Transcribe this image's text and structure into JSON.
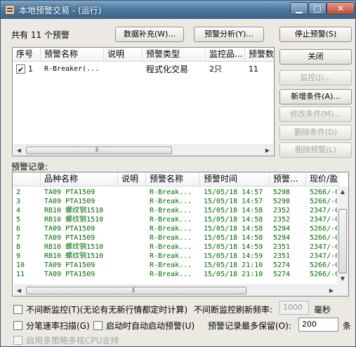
{
  "window": {
    "title": "本地预警交易 - (运行)"
  },
  "toolbar": {
    "count_label": "共有 11 个预警",
    "data_fill_button": "数据补充(W)...",
    "analysis_button": "预警分析(Y)...",
    "stop_button": "停止预警(S)"
  },
  "side_buttons": {
    "close": "关闭",
    "monitor": "监控(J)...",
    "add_condition": "新增条件(A)...",
    "modify_condition": "修改条件(M)...",
    "delete_condition": "删除条件(D)",
    "delete_alert": "删除预警(L)"
  },
  "alert_list": {
    "columns": [
      "序号",
      "预警名称",
      "说明",
      "预警类型",
      "监控品...",
      "预警数"
    ],
    "rows": [
      {
        "checked": true,
        "index": "1",
        "name": "R-Breaker(...",
        "desc": "",
        "type": "程式化交易",
        "products": "2只",
        "count": "11"
      }
    ]
  },
  "records": {
    "label": "预警记录:",
    "columns": [
      "",
      "品种名称",
      "说明",
      "预警名称",
      "预警时间",
      "预警...",
      "现价/盈"
    ],
    "rows": [
      {
        "num": "2",
        "product": "TA09 PTA1509",
        "desc": "",
        "alert": "R-Break...",
        "time": "15/05/18 14:57",
        "price": "5298",
        "cur": "5266/-0"
      },
      {
        "num": "3",
        "product": "TA09 PTA1509",
        "desc": "",
        "alert": "R-Break...",
        "time": "15/05/18 14:57",
        "price": "5298",
        "cur": "5266/-0"
      },
      {
        "num": "4",
        "product": "RB10 螺纹钢1510",
        "desc": "",
        "alert": "R-Break...",
        "time": "15/05/18 14:58",
        "price": "2352",
        "cur": "2347/-0"
      },
      {
        "num": "5",
        "product": "RB10 螺纹钢1510",
        "desc": "",
        "alert": "R-Break...",
        "time": "15/05/18 14:58",
        "price": "2352",
        "cur": "2347/-0"
      },
      {
        "num": "6",
        "product": "TA09 PTA1509",
        "desc": "",
        "alert": "R-Break...",
        "time": "15/05/18 14:58",
        "price": "5294",
        "cur": "5266/-0"
      },
      {
        "num": "7",
        "product": "TA09 PTA1509",
        "desc": "",
        "alert": "R-Break...",
        "time": "15/05/18 14:58",
        "price": "5294",
        "cur": "5266/-0"
      },
      {
        "num": "8",
        "product": "RB10 螺纹钢1510",
        "desc": "",
        "alert": "R-Break...",
        "time": "15/05/18 14:59",
        "price": "2351",
        "cur": "2347/-0"
      },
      {
        "num": "9",
        "product": "RB10 螺纹钢1510",
        "desc": "",
        "alert": "R-Break...",
        "time": "15/05/18 14:59",
        "price": "2351",
        "cur": "2347/-0"
      },
      {
        "num": "10",
        "product": "TA09 PTA1509",
        "desc": "",
        "alert": "R-Break...",
        "time": "15/05/18 21:10",
        "price": "5274",
        "cur": "5266/-0"
      },
      {
        "num": "11",
        "product": "TA09 PTA1509",
        "desc": "",
        "alert": "R-Break...",
        "time": "15/05/18 21:10",
        "price": "5274",
        "cur": "5266/-0"
      }
    ]
  },
  "options": {
    "continuous_monitor": {
      "label": "不间断监控(T)(无论有无新行情都定时计算)",
      "checked": false
    },
    "refresh_label": "不间断监控刷新频率:",
    "refresh_value": "1000",
    "refresh_unit": "毫秒",
    "tick_scan": {
      "label": "分笔速率扫描(G)",
      "checked": false
    },
    "auto_start": {
      "label": "启动时自动启动预警(U)",
      "checked": false
    },
    "max_records_label": "预警记录最多保留(O):",
    "max_records_value": "200",
    "max_records_unit": "条",
    "multi_cpu": {
      "label": "启用多策略多核CPU支持",
      "checked": false
    }
  },
  "colors": {
    "record_text": "#006b00",
    "titlebar": "#4f7aa0"
  },
  "icons": [
    "app-icon",
    "minimize-icon",
    "maximize-icon",
    "close-icon",
    "scroll-left-icon",
    "scroll-right-icon",
    "scroll-up-icon",
    "scroll-down-icon"
  ]
}
